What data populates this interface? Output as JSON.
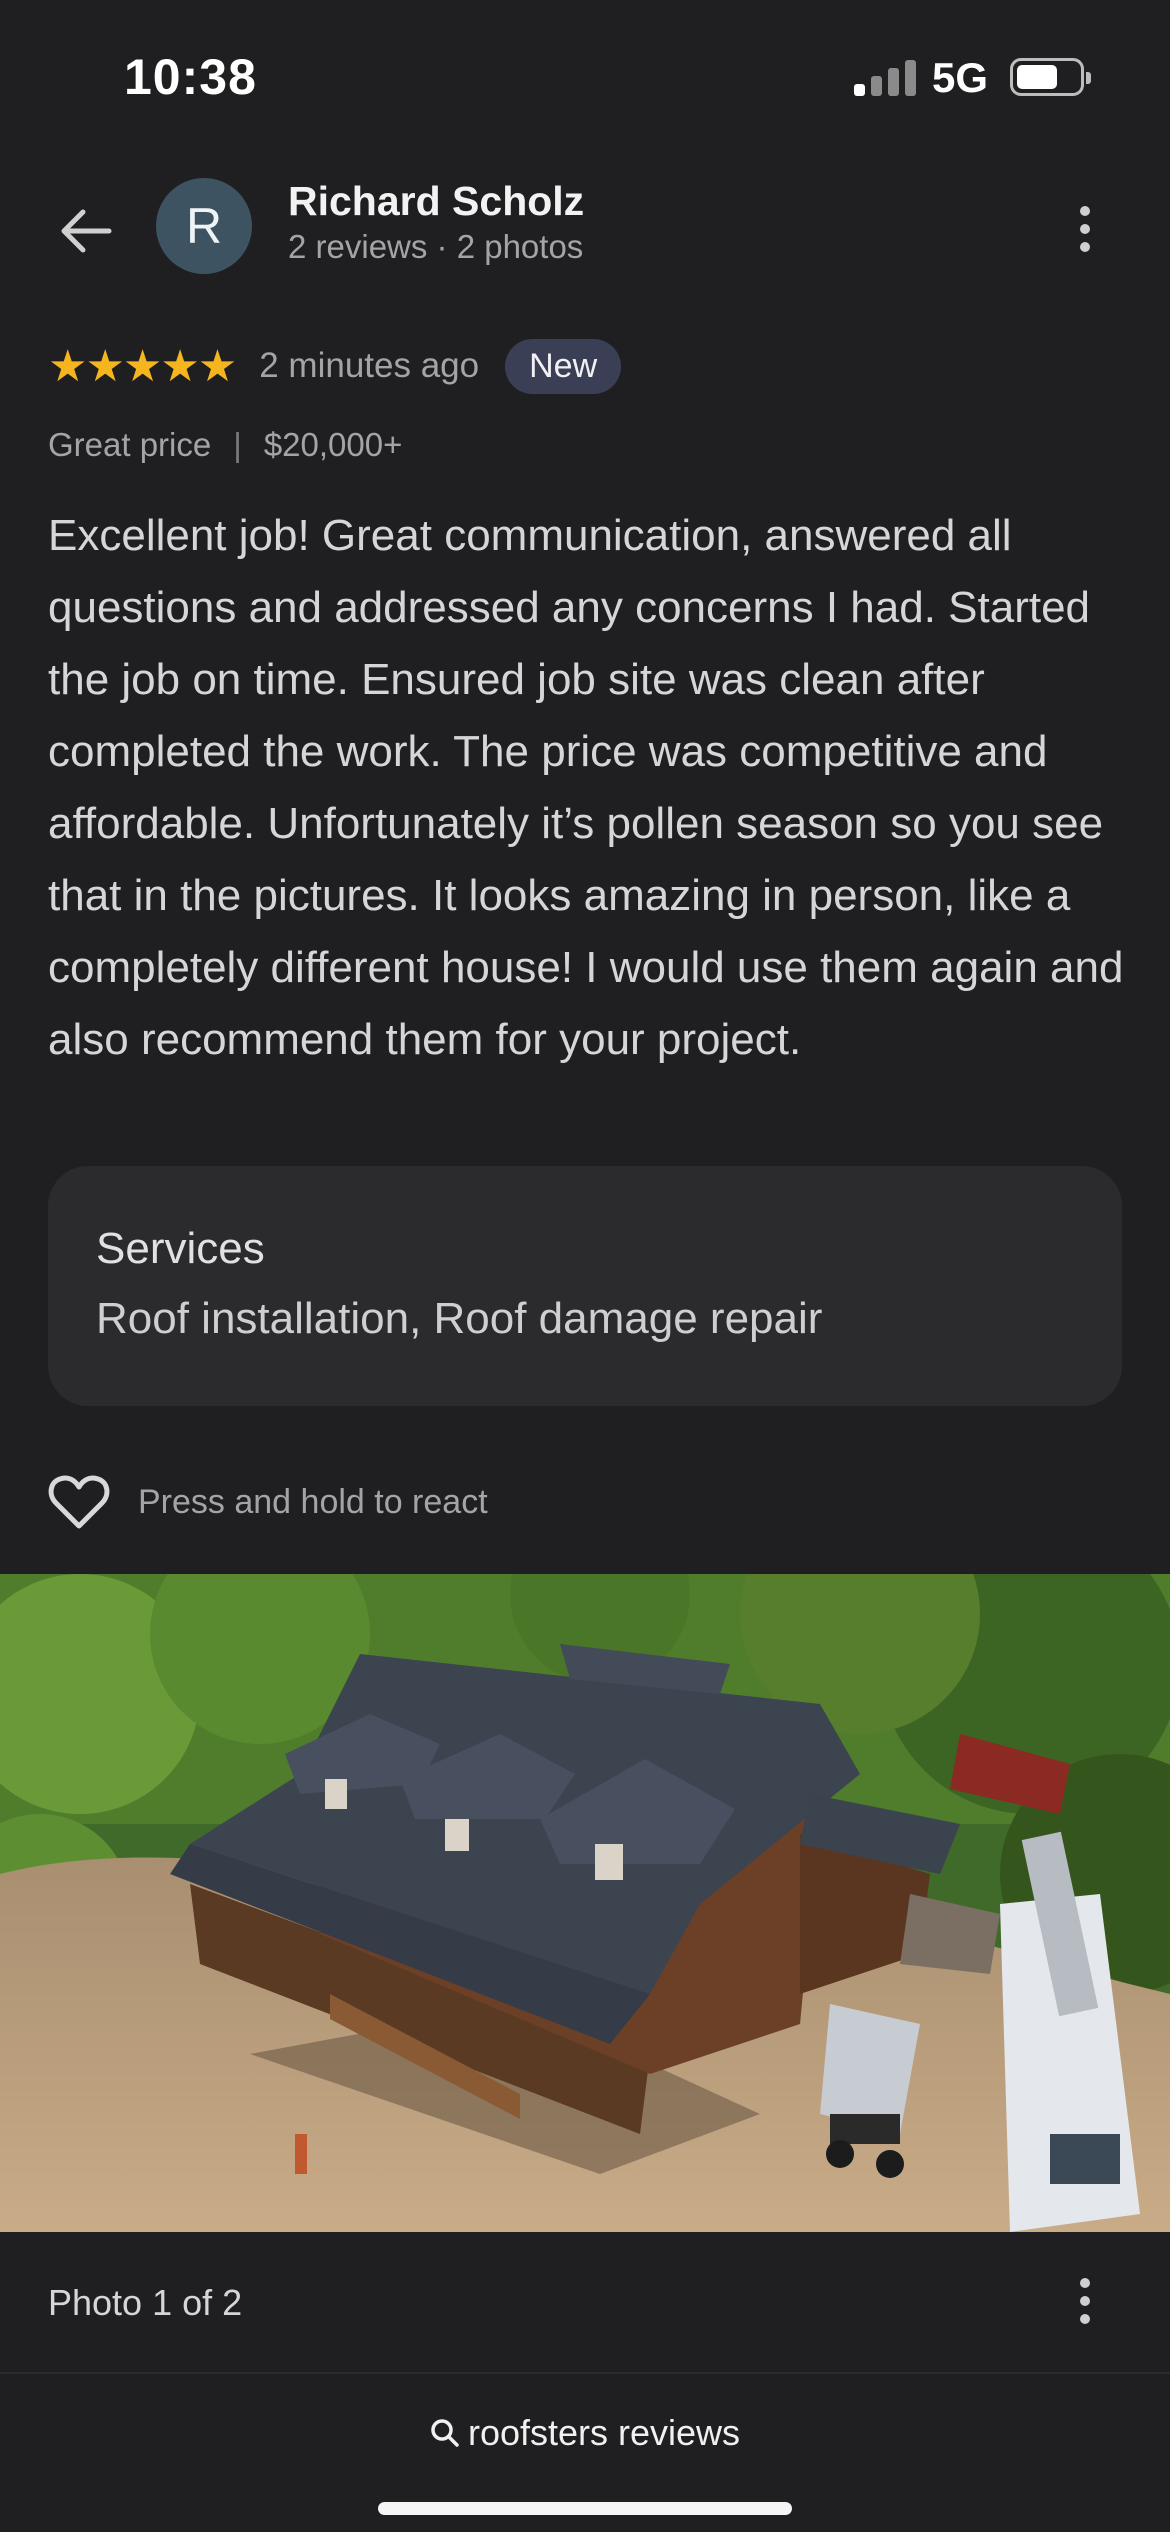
{
  "status_bar": {
    "time": "10:38",
    "network": "5G",
    "icons": [
      "signal-icon",
      "battery-icon"
    ]
  },
  "header": {
    "back_icon": "arrow-left-icon",
    "avatar_initial": "R",
    "reviewer_name": "Richard Scholz",
    "reviewer_meta": "2 reviews · 2 photos",
    "more_icon": "more-vertical-icon"
  },
  "review": {
    "rating": 5,
    "stars": "★★★★★",
    "time_ago": "2 minutes ago",
    "badge": "New",
    "tag_price_quality": "Great price",
    "tag_price_range": "$20,000+",
    "text": "Excellent job! Great communication, answered all questions and addressed any concerns I had. Started the job on time. Ensured job site was clean after completed the work. The price was competitive and affordable. Unfortunately it’s pollen season so you see that in the pictures. It looks amazing in person, like a completely different house! I would use them again and also recommend them for your project."
  },
  "services": {
    "title": "Services",
    "list": "Roof installation, Roof damage repair"
  },
  "react": {
    "icon": "heart-outline-icon",
    "label": "Press and hold to react"
  },
  "photo": {
    "counter": "Photo 1 of 2",
    "more_icon": "more-vertical-icon"
  },
  "search": {
    "icon": "search-icon",
    "query": "roofsters reviews"
  },
  "colors": {
    "background": "#1f1f21",
    "star": "#f5b51e",
    "badge_bg": "#3b3f55",
    "card_bg": "#2b2b2e",
    "avatar_bg": "#3e5361"
  }
}
